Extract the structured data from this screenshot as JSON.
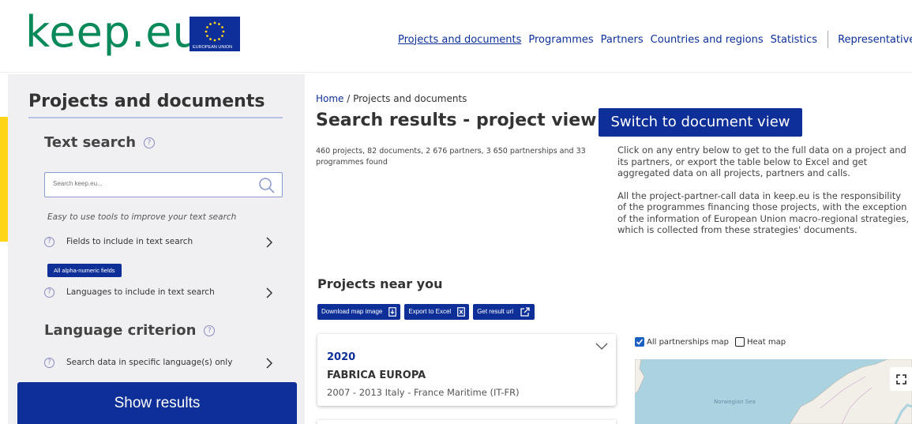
{
  "header": {
    "logo_text": "keep.eu",
    "eu_label": "EUROPEAN UNION",
    "nav": [
      {
        "label": "Projects and documents",
        "active": true
      },
      {
        "label": "Programmes",
        "active": false
      },
      {
        "label": "Partners",
        "active": false
      },
      {
        "label": "Countries and regions",
        "active": false
      },
      {
        "label": "Statistics",
        "active": false
      },
      {
        "label": "Representativeness",
        "active": false
      }
    ]
  },
  "sidebar": {
    "title": "Projects and documents",
    "text_search": {
      "heading": "Text search",
      "placeholder": "Search keep.eu...",
      "hint": "Easy to use tools to improve your text search",
      "fields_label": "Fields to include in text search",
      "fields_tag": "All alpha-numeric fields",
      "languages_label": "Languages to include in text search"
    },
    "language_criterion": {
      "heading": "Language criterion",
      "option_label": "Search data in specific language(s) only"
    },
    "show_results": "Show results"
  },
  "main": {
    "breadcrumb": {
      "home": "Home",
      "separator": " / ",
      "current": "Projects and documents"
    },
    "title": "Search results - project view",
    "switch_button": "Switch to document view",
    "counts": "460 projects, 82 documents, 2 676 partners, 3 650 partnerships and 33 programmes found",
    "description_1": "Click on any entry below to get to the full data on a project and its partners, or export the table below to Excel and get aggregated data on all projects, partners and calls.",
    "description_2": "All the project-partner-call data in keep.eu is the responsibility of the programmes financing those projects, with the exception of the information of European Union macro-regional strategies, which is collected from these strategies' documents.",
    "near_heading": "Projects near you",
    "tools": {
      "download": "Download map image",
      "export": "Export to Excel",
      "result_url": "Get result url"
    },
    "project_card": {
      "year": "2020",
      "name": "FABRICA EUROPA",
      "programme": "2007 - 2013 Italy - France Maritime (IT-FR)"
    },
    "map": {
      "all_partnerships": {
        "label": "All partnerships map",
        "checked": true
      },
      "heat_map": {
        "label": "Heat map",
        "checked": false
      },
      "sea_label": "Norwegian Sea"
    }
  },
  "colors": {
    "brand_blue": "#0d2f97",
    "logo_green": "#0a8a5a",
    "accent_yellow": "#ffd617",
    "sidebar_bg": "#f0f0f3",
    "map_sea": "#aad3df"
  }
}
